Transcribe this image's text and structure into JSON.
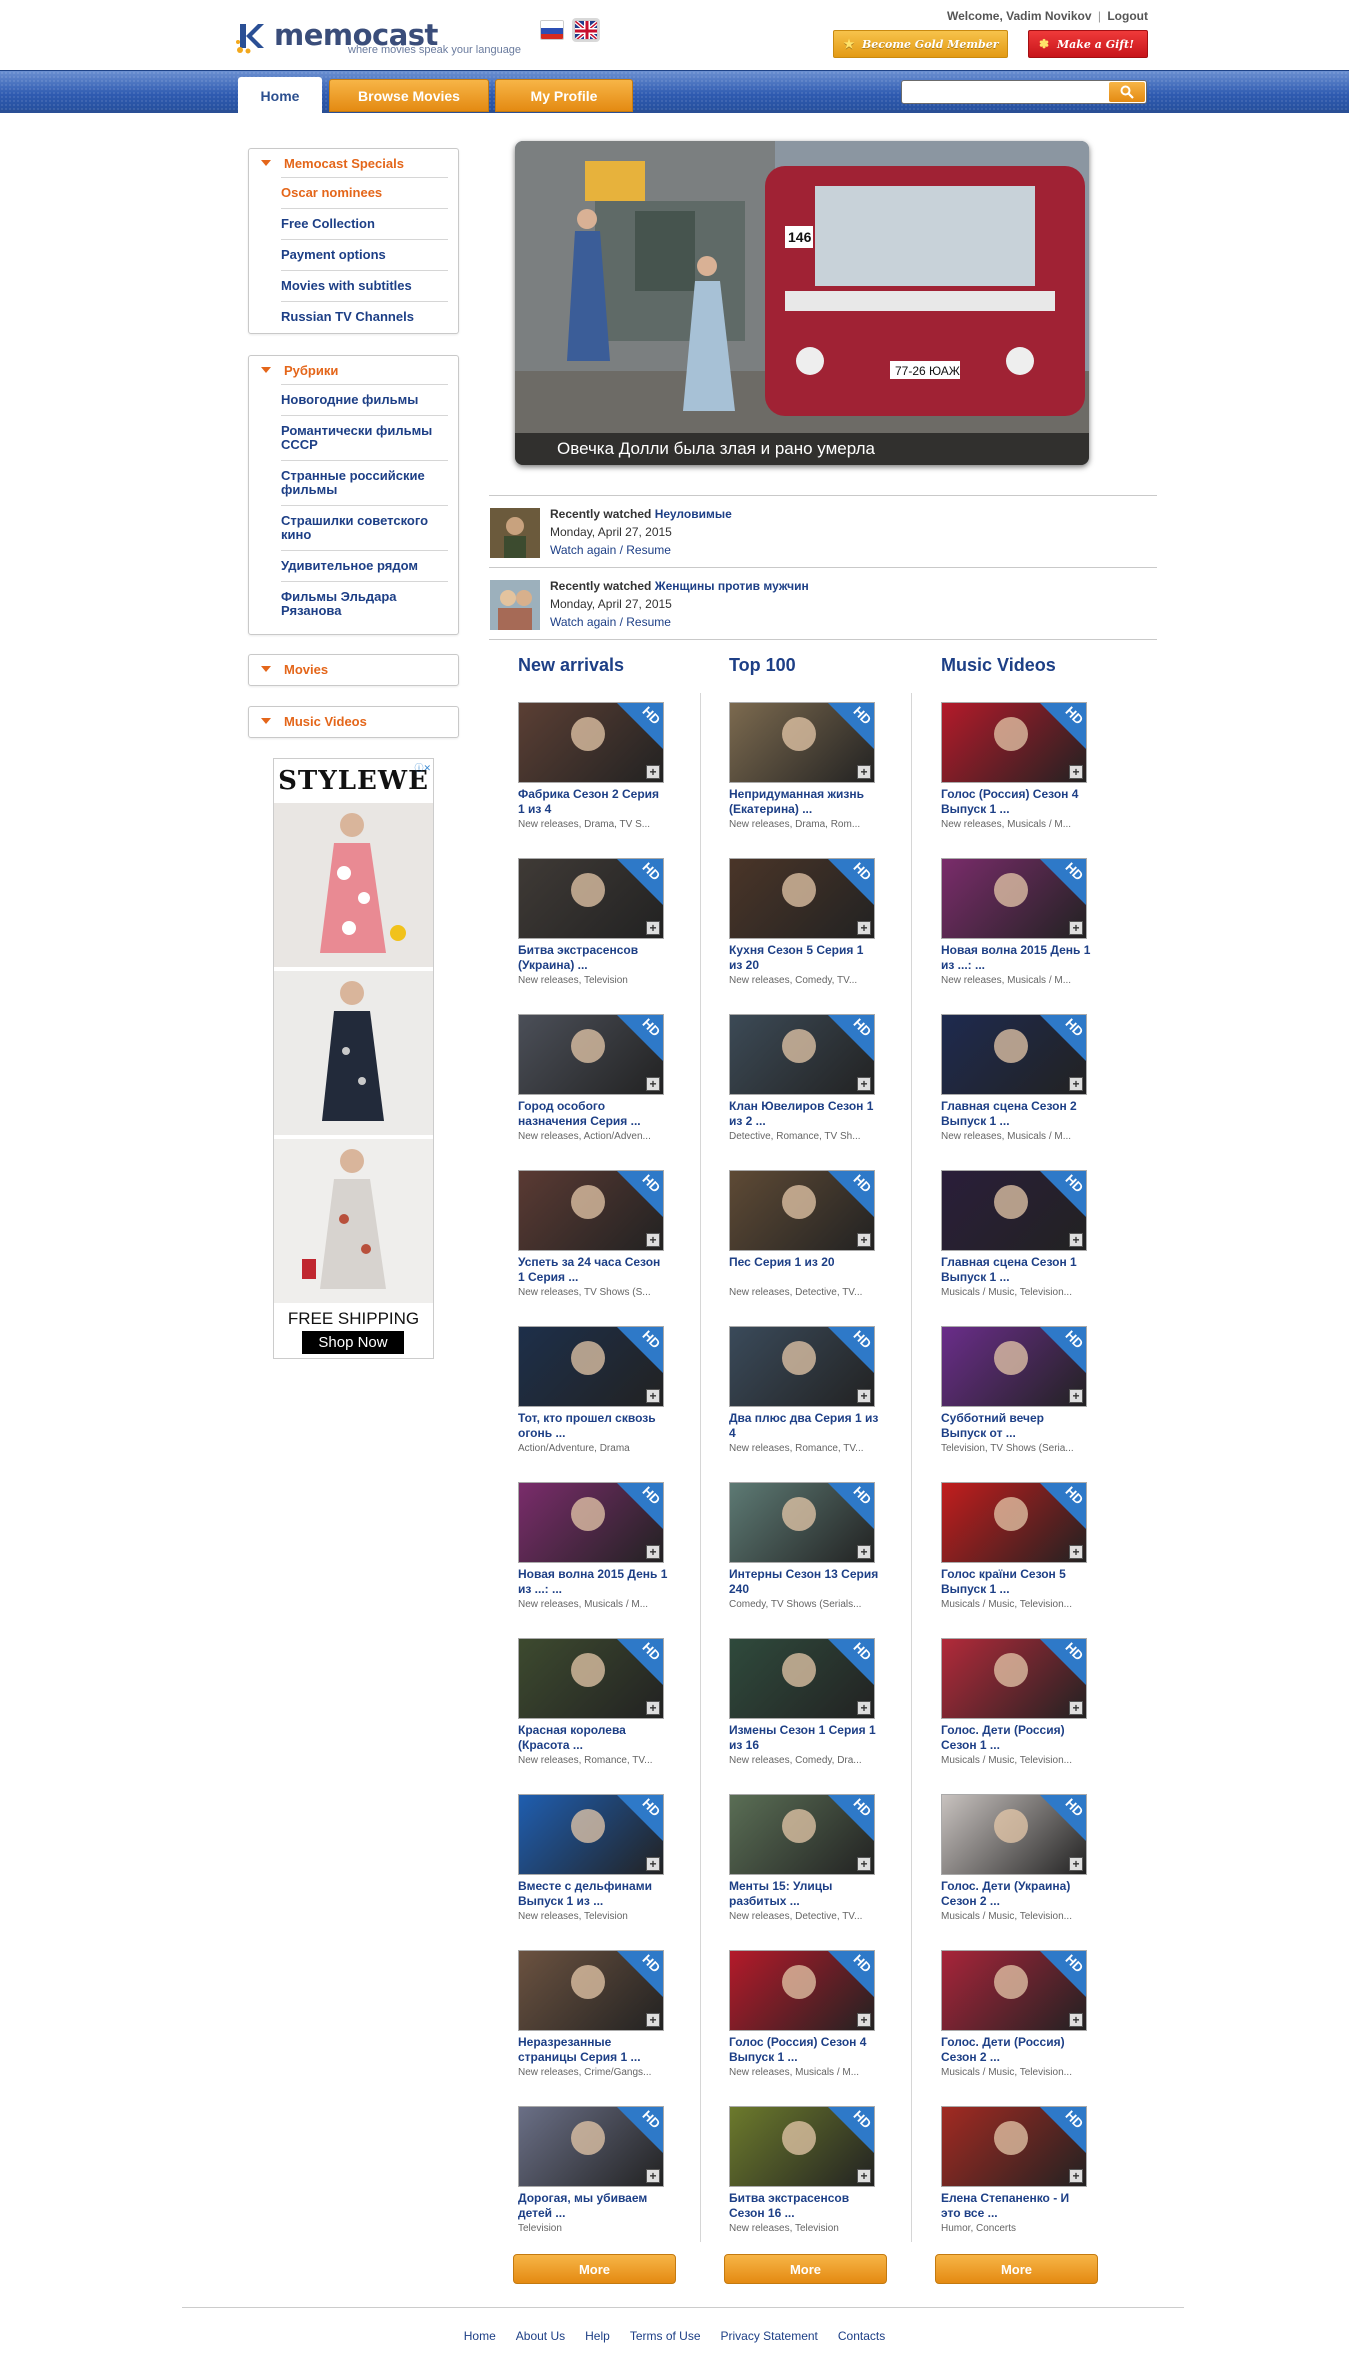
{
  "header": {
    "logo_text": "memocast",
    "logo_tagline": "where movies speak your language",
    "welcome_prefix": "Welcome,",
    "user_name": "Vadim Novikov",
    "logout_label": "Logout",
    "gold_label": "Become Gold Member",
    "gift_label": "Make a Gift!"
  },
  "nav": {
    "tabs": [
      {
        "label": "Home"
      },
      {
        "label": "Browse Movies"
      },
      {
        "label": "My Profile"
      }
    ],
    "search_value": ""
  },
  "sidebar": {
    "specials": {
      "title": "Memocast Specials",
      "items": [
        "Oscar nominees",
        "Free Collection",
        "Payment options",
        "Movies with subtitles",
        "Russian TV Channels"
      ]
    },
    "rubrics": {
      "title": "Рубрики",
      "items": [
        "Новогодние фильмы",
        "Романтически фильмы СССР",
        "Странные российские фильмы",
        "Страшилки советского кино",
        "Удивительное рядом",
        "Фильмы Эльдара Рязанова"
      ]
    },
    "movies_title": "Movies",
    "music_title": "Music Videos",
    "ad": {
      "brand": "STYLEWE",
      "shipping": "FREE SHIPPING",
      "shop": "Shop Now"
    }
  },
  "hero": {
    "caption": "Овечка Долли была злая и рано умерла",
    "bus_route": "146",
    "plate": "77-26 ЮАЖ"
  },
  "recent": [
    {
      "label": "Recently watched",
      "title": "Неуловимые",
      "date": "Monday, April 27, 2015",
      "link": "Watch again / Resume"
    },
    {
      "label": "Recently watched",
      "title": "Женщины против мужчин",
      "date": "Monday, April 27, 2015",
      "link": "Watch again / Resume"
    }
  ],
  "columns": [
    {
      "title": "New arrivals",
      "more": "More",
      "items": [
        {
          "title": "Фабрика Сезон 2 Серия 1 из 4",
          "meta": "New releases, Drama, TV S...",
          "bg": "#5b3f34"
        },
        {
          "title": "Битва экстрасенсов (Украина) ...",
          "meta": "New releases, Television",
          "bg": "#3f3a36"
        },
        {
          "title": "Город особого назначения Серия ...",
          "meta": "New releases, Action/Adven...",
          "bg": "#4b4f58"
        },
        {
          "title": "Успеть за 24 часа Сезон 1 Серия ...",
          "meta": "New releases, TV Shows (S...",
          "bg": "#5a3a33"
        },
        {
          "title": "Тот, кто прошел сквозь огонь ...",
          "meta": "Action/Adventure, Drama",
          "bg": "#1d2f4a"
        },
        {
          "title": "Новая волна 2015 День 1 из ...: ...",
          "meta": "New releases, Musicals / M...",
          "bg": "#7a2c6b"
        },
        {
          "title": "Красная королева (Красота ...",
          "meta": "New releases, Romance, TV...",
          "bg": "#3d4a2f"
        },
        {
          "title": "Вместе с дельфинами Выпуск 1 из ...",
          "meta": "New releases, Television",
          "bg": "#1f5eb0"
        },
        {
          "title": "Неразрезанные страницы Серия 1 ...",
          "meta": "New releases, Crime/Gangs...",
          "bg": "#6b5240"
        },
        {
          "title": "Дорогая, мы убиваем детей ...",
          "meta": "Television",
          "bg": "#6a6f86"
        }
      ]
    },
    {
      "title": "Top 100",
      "more": "More",
      "items": [
        {
          "title": "Непридуманная жизнь (Екатерина) ...",
          "meta": "New releases, Drama, Rom...",
          "bg": "#7c6a4f"
        },
        {
          "title": "Кухня Сезон 5 Серия 1 из 20",
          "meta": "New releases, Comedy, TV...",
          "bg": "#4a3528"
        },
        {
          "title": "Клан Ювелиров Сезон 1 из 2 ...",
          "meta": "Detective, Romance, TV Sh...",
          "bg": "#3c4a56"
        },
        {
          "title": "Пес Серия 1 из 20",
          "meta": "New releases, Detective, TV...",
          "bg": "#5e4a35"
        },
        {
          "title": "Два плюс два Серия 1 из 4",
          "meta": "New releases, Romance, TV...",
          "bg": "#3a4a5a"
        },
        {
          "title": "Интерны Сезон 13 Серия 240",
          "meta": "Comedy, TV Shows (Serials...",
          "bg": "#5d7a74"
        },
        {
          "title": "Измены Сезон 1 Серия 1 из 16",
          "meta": "New releases, Comedy, Dra...",
          "bg": "#2f4a3c"
        },
        {
          "title": "Менты 15: Улицы разбитых ...",
          "meta": "New releases, Detective, TV...",
          "bg": "#5a6e55"
        },
        {
          "title": "Голос (Россия) Сезон 4 Выпуск 1 ...",
          "meta": "New releases, Musicals / M...",
          "bg": "#b41a2a"
        },
        {
          "title": "Битва экстрасенсов Сезон 16 ...",
          "meta": "New releases, Television",
          "bg": "#6c7a2c"
        }
      ]
    },
    {
      "title": "Music Videos",
      "more": "More",
      "items": [
        {
          "title": "Голос (Россия) Сезон 4 Выпуск 1 ...",
          "meta": "New releases, Musicals / M...",
          "bg": "#b41a2a"
        },
        {
          "title": "Новая волна 2015 День 1 из ...: ...",
          "meta": "New releases, Musicals / M...",
          "bg": "#7a2c6b"
        },
        {
          "title": "Главная сцена Сезон 2 Выпуск 1 ...",
          "meta": "New releases, Musicals / M...",
          "bg": "#1e2a4f"
        },
        {
          "title": "Главная сцена Сезон 1 Выпуск 1 ...",
          "meta": "Musicals / Music, Television...",
          "bg": "#2a1e3a"
        },
        {
          "title": "Субботний вечер Выпуск от ...",
          "meta": "Television, TV Shows (Seria...",
          "bg": "#6a2d8a"
        },
        {
          "title": "Голос країни Сезон 5 Выпуск 1 ...",
          "meta": "Musicals / Music, Television...",
          "bg": "#c21d1d"
        },
        {
          "title": "Голос. Дети (Россия) Сезон 1 ...",
          "meta": "Musicals / Music, Television...",
          "bg": "#b22a3a"
        },
        {
          "title": "Голос. Дети (Украина) Сезон 2 ...",
          "meta": "Musicals / Music, Television...",
          "bg": "#c8c2bf"
        },
        {
          "title": "Голос. Дети (Россия) Сезон 2 ...",
          "meta": "Musicals / Music, Television...",
          "bg": "#a8243a"
        },
        {
          "title": "Елена Степаненко - И это все ...",
          "meta": "Humor, Concerts",
          "bg": "#a22a22"
        }
      ]
    }
  ],
  "footer": {
    "links": [
      "Home",
      "About Us",
      "Help",
      "Terms of Use",
      "Privacy Statement",
      "Contacts"
    ]
  },
  "colors": {
    "accent_orange": "#e4661a",
    "link_blue": "#1d3f86",
    "nav_blue": "#2f5bb1",
    "hd_blue": "#2e79c8"
  }
}
